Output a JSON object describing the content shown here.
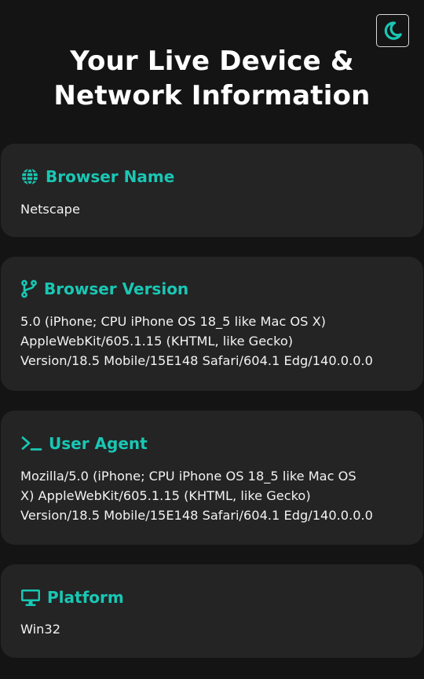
{
  "header": {
    "title_line1": "Your Live Device &",
    "title_line2": "Network Information",
    "theme_toggle_icon": "moon-icon"
  },
  "colors": {
    "background": "#141414",
    "card": "#242424",
    "accent": "#19c7b4",
    "text": "#f2f2f2"
  },
  "cards": [
    {
      "icon": "globe-icon",
      "title": "Browser Name",
      "lines": [
        "Netscape"
      ]
    },
    {
      "icon": "code-branch-icon",
      "title": "Browser Version",
      "lines": [
        "5.0 (iPhone; CPU iPhone OS 18_5 like Mac OS X)",
        "AppleWebKit/605.1.15 (KHTML, like Gecko)",
        "Version/18.5 Mobile/15E148 Safari/604.1 Edg/140.0.0.0"
      ]
    },
    {
      "icon": "terminal-icon",
      "title": "User Agent",
      "lines": [
        "Mozilla/5.0 (iPhone; CPU iPhone OS 18_5 like Mac OS",
        "X) AppleWebKit/605.1.15 (KHTML, like Gecko)",
        "Version/18.5 Mobile/15E148 Safari/604.1 Edg/140.0.0.0"
      ]
    },
    {
      "icon": "monitor-icon",
      "title": "Platform",
      "lines": [
        "Win32"
      ]
    }
  ]
}
